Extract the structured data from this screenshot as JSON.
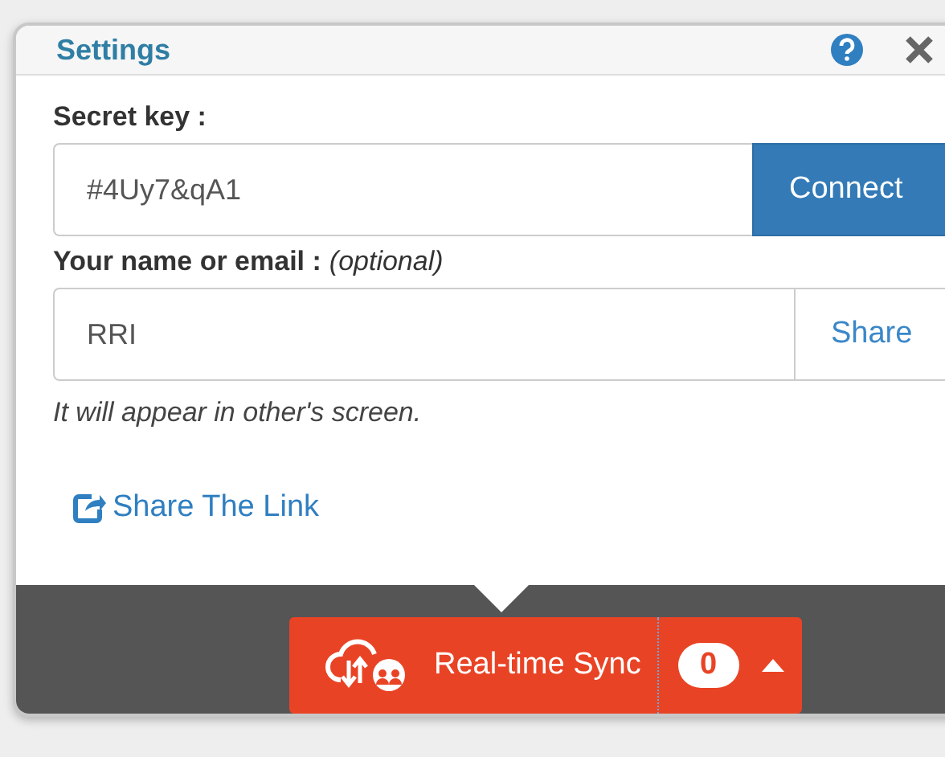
{
  "window": {
    "title": "Settings"
  },
  "secret_key": {
    "label": "Secret key :",
    "value": "#4Uy7&qA1",
    "button": "Connect"
  },
  "name_field": {
    "label": "Your name or email :",
    "label_note": "(optional)",
    "value": "RRI",
    "button": "Share",
    "hint": "It will appear in other's screen."
  },
  "share_link": "Share The Link",
  "sync_button": {
    "label": "Real-time Sync",
    "count": "0"
  }
}
